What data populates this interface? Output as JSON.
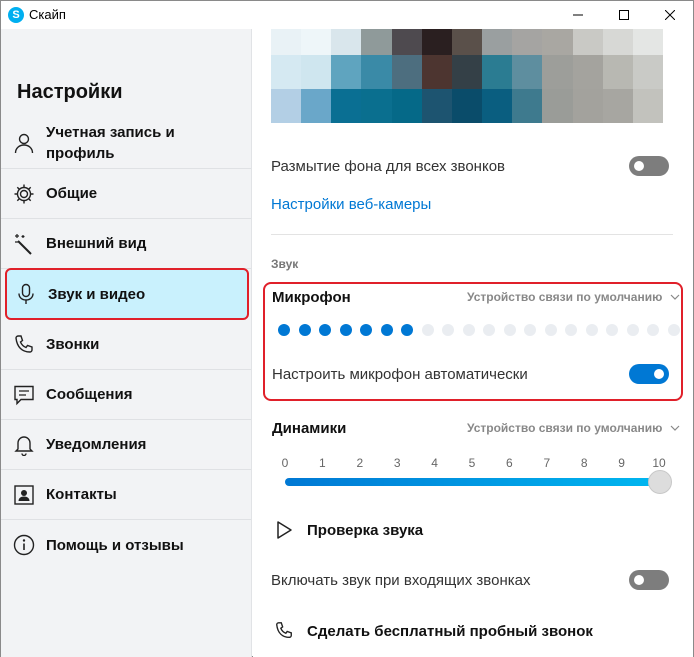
{
  "window": {
    "title": "Скайп"
  },
  "sidebar": {
    "title": "Настройки",
    "items": [
      {
        "label_line1": "Учетная запись и",
        "label_line2": "профиль",
        "icon": "person-icon"
      },
      {
        "label": "Общие",
        "icon": "gear-icon"
      },
      {
        "label": "Внешний вид",
        "icon": "magic-wand-icon"
      },
      {
        "label": "Звук и видео",
        "icon": "microphone-icon",
        "active": true
      },
      {
        "label": "Звонки",
        "icon": "phone-icon"
      },
      {
        "label": "Сообщения",
        "icon": "message-icon"
      },
      {
        "label": "Уведомления",
        "icon": "bell-icon"
      },
      {
        "label": "Контакты",
        "icon": "contact-card-icon"
      },
      {
        "label": "Помощь и отзывы",
        "icon": "info-icon"
      }
    ]
  },
  "video": {
    "blur_label": "Размытие фона для всех звонков",
    "blur_enabled": false,
    "webcam_settings_link": "Настройки веб-камеры",
    "preview_colors": [
      "#e9f2f6",
      "#eef6f9",
      "#d9e6ec",
      "#8f9a9a",
      "#4e4a4f",
      "#2a1f20",
      "#5a504a",
      "#9a9fa0",
      "#a5a4a2",
      "#a9a7a2",
      "#c9c9c5",
      "#d7d8d5",
      "#e4e6e4",
      "#d5e9f2",
      "#cfe6ef",
      "#5fa4bf",
      "#3a8aa7",
      "#4d6e7f",
      "#4d3530",
      "#344047",
      "#2b7c92",
      "#5e8e9f",
      "#9d9e9a",
      "#a4a39e",
      "#b8b8b2",
      "#c9cac6",
      "#b3cfe5",
      "#6aa7c9",
      "#0a6f93",
      "#0a6f8f",
      "#056988",
      "#1d5470",
      "#0a4c6a",
      "#0a5e80",
      "#3e7a8e",
      "#9a9c98",
      "#a3a29d",
      "#a7a6a1",
      "#c2c2bd"
    ]
  },
  "audio": {
    "section_label": "Звук",
    "microphone": {
      "title": "Микрофон",
      "device": "Устройство связи по умолчанию",
      "level_active": 7,
      "level_total": 20,
      "auto_label": "Настроить микрофон автоматически",
      "auto_enabled": true
    },
    "speakers": {
      "title": "Динамики",
      "device": "Устройство связи по умолчанию",
      "ticks": [
        "0",
        "1",
        "2",
        "3",
        "4",
        "5",
        "6",
        "7",
        "8",
        "9",
        "10"
      ],
      "volume": 10
    },
    "test_sound": "Проверка звука",
    "incoming_ring_label": "Включать звук при входящих звонках",
    "incoming_ring_enabled": false,
    "free_test_call": "Сделать бесплатный пробный звонок"
  }
}
